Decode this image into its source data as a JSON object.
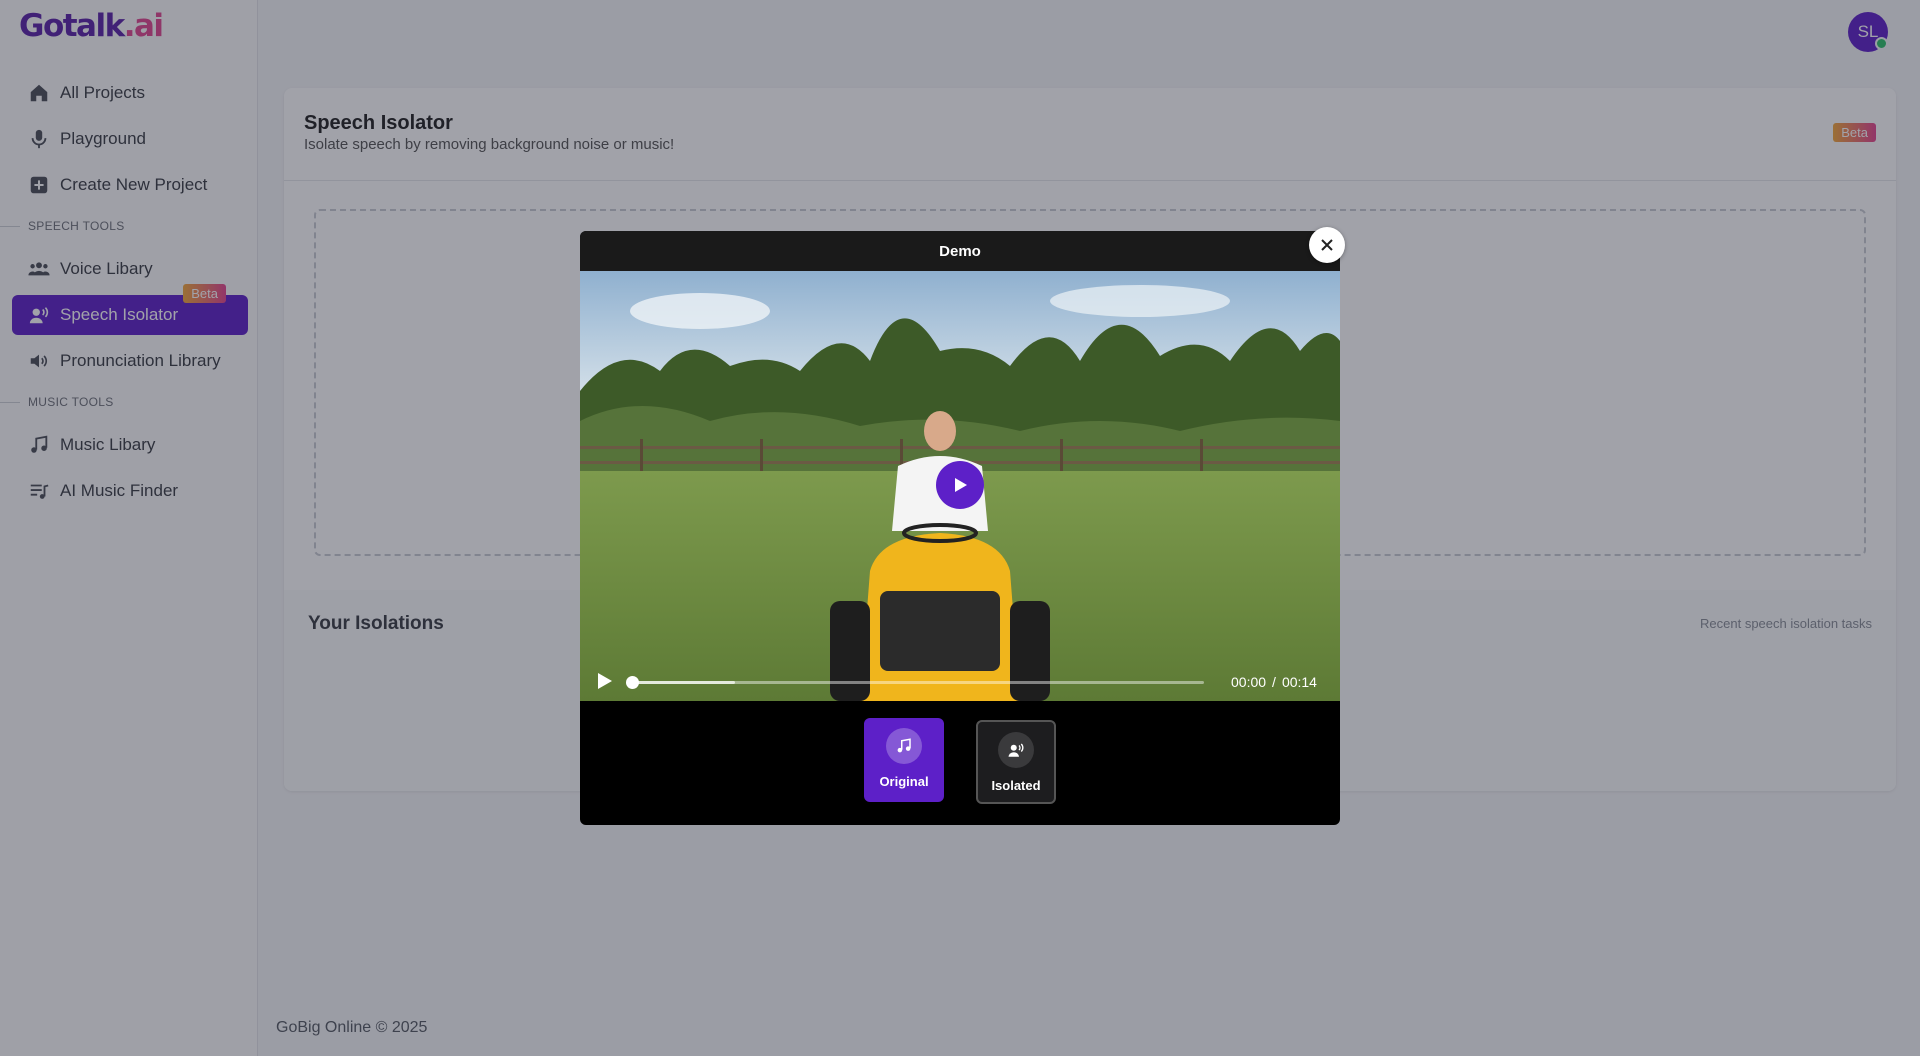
{
  "brand": {
    "logo_main": "Gotalk",
    "logo_dot": ".ai"
  },
  "sidebar": {
    "items": [
      {
        "label": "All Projects",
        "icon": "home-icon"
      },
      {
        "label": "Playground",
        "icon": "microphone-icon"
      },
      {
        "label": "Create New Project",
        "icon": "plus-square-icon"
      },
      {
        "label": "Voice Libary",
        "icon": "users-icon"
      },
      {
        "label": "Speech Isolator",
        "icon": "speaker-person-icon",
        "active": true,
        "badge": "Beta"
      },
      {
        "label": "Pronunciation Library",
        "icon": "volume-icon"
      },
      {
        "label": "Music Libary",
        "icon": "music-note-icon"
      },
      {
        "label": "AI Music Finder",
        "icon": "playlist-icon"
      }
    ],
    "sections": {
      "speech": "SPEECH TOOLS",
      "music": "MUSIC TOOLS"
    }
  },
  "user": {
    "initials": "SL",
    "status_color": "#2ec26a"
  },
  "main": {
    "title": "Speech Isolator",
    "subtitle": "Isolate speech by removing background noise or music!",
    "badge": "Beta",
    "isolations": {
      "title": "Your Isolations",
      "subtitle": "Recent speech isolation tasks"
    }
  },
  "footer": {
    "text": "GoBig Online © 2025"
  },
  "modal": {
    "title": "Demo",
    "player": {
      "current_time": "00:00",
      "separator": "/",
      "duration": "00:14",
      "progress": 0.0,
      "buffered": 0.18
    },
    "toggles": [
      {
        "label": "Original",
        "icon": "music-note-icon",
        "selected": true
      },
      {
        "label": "Isolated",
        "icon": "voice-person-icon",
        "selected": false
      }
    ]
  },
  "colors": {
    "accent": "#5d20c8",
    "beta_gradient_start": "#f4a93a",
    "beta_gradient_end": "#e64591"
  }
}
